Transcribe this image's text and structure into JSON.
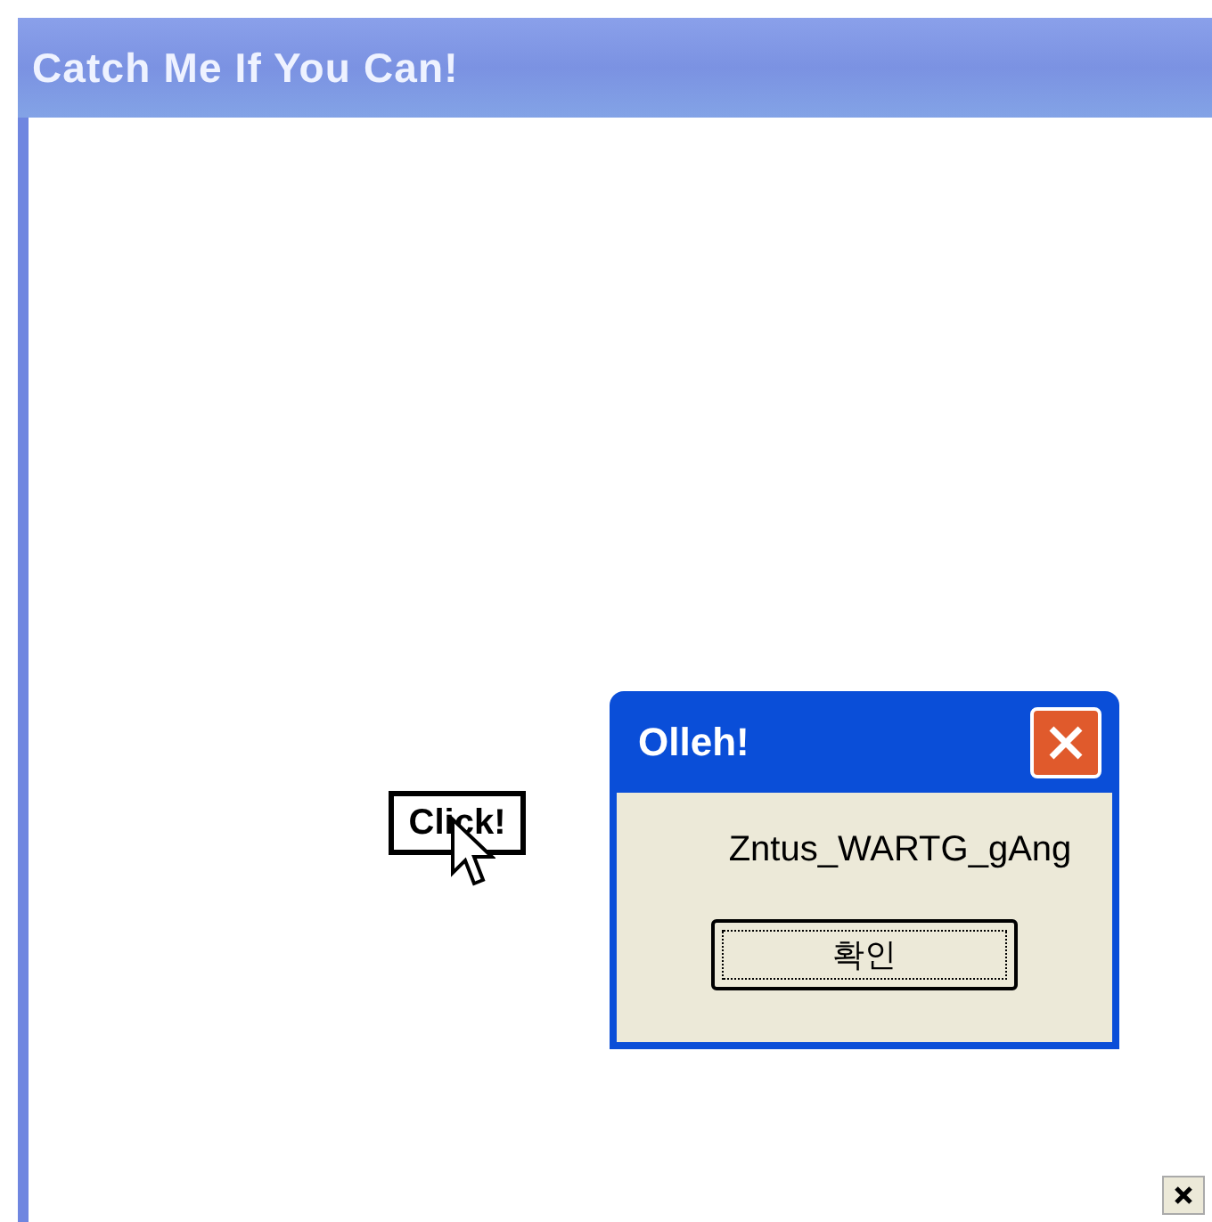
{
  "window": {
    "title": "Catch Me If You Can!"
  },
  "click_button": {
    "label": "Click!"
  },
  "dialog": {
    "title": "Olleh!",
    "message": "Zntus_WARTG_gAng",
    "ok_button": "확인"
  }
}
